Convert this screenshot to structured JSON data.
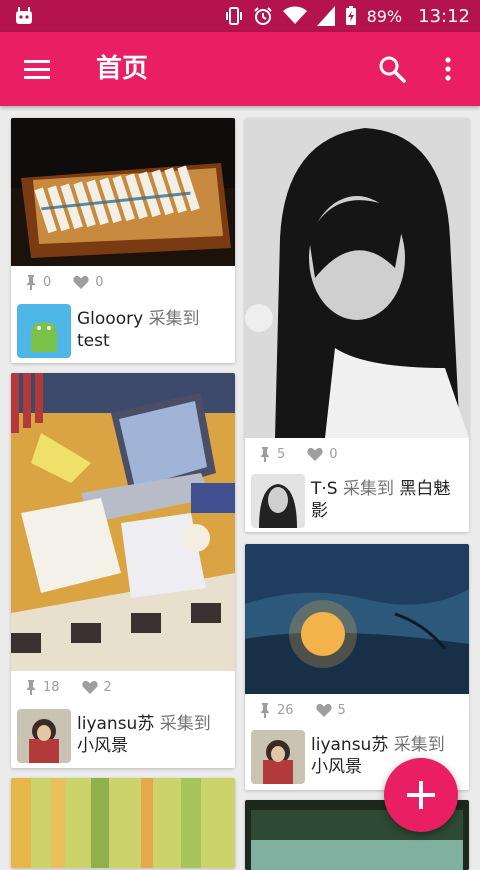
{
  "status_bar": {
    "battery": "89%",
    "time": "13:12"
  },
  "app_bar": {
    "title": "首页",
    "menu_icon": "menu-icon",
    "search_icon": "search-icon",
    "more_icon": "more-vert-icon"
  },
  "colors": {
    "primary": "#e91e63",
    "status_bar": "#b5134d",
    "background": "#ececec"
  },
  "feed": [
    {
      "pins": "0",
      "likes": "0",
      "user": "Glooory",
      "action": "采集到",
      "board": "test"
    },
    {
      "pins": "5",
      "likes": "0",
      "user": "T·S",
      "action": "采集到",
      "board": "黑白魅影"
    },
    {
      "pins": "18",
      "likes": "2",
      "user": "liyansu苏",
      "action": "采集到",
      "board": "小风景"
    },
    {
      "pins": "26",
      "likes": "5",
      "user": "liyansu苏",
      "action": "采集到",
      "board": "小风景"
    }
  ],
  "fab": {
    "icon": "add-icon"
  }
}
